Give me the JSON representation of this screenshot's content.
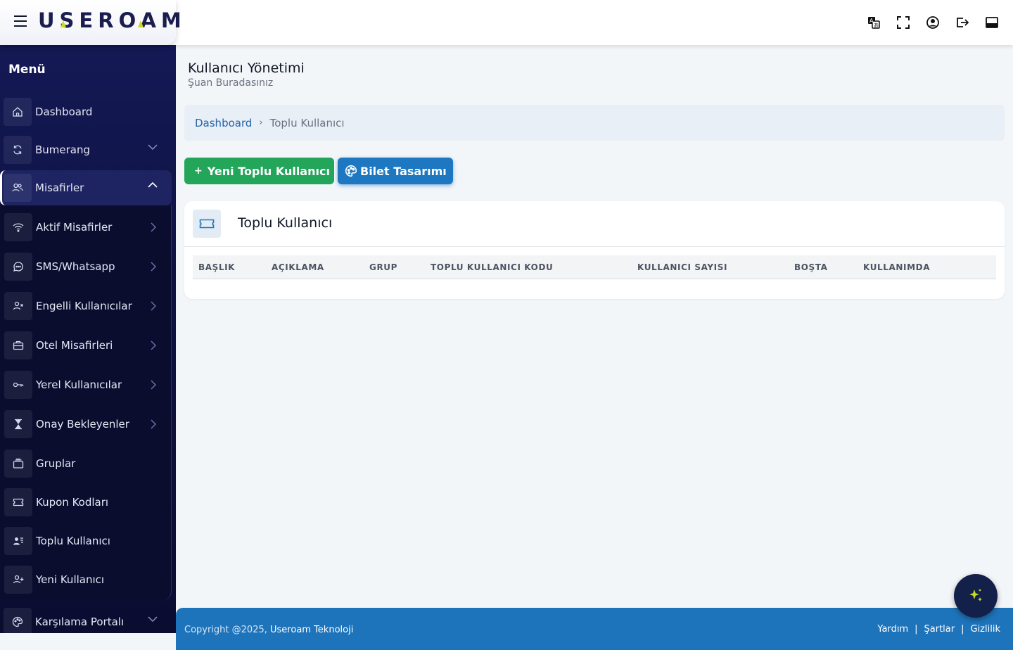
{
  "brand": {
    "logo_text": "USEROAM",
    "accent_color": "#c8d92b",
    "navy": "#1a1d4e"
  },
  "topbar": {
    "icons": [
      "translate-icon",
      "fullscreen-icon",
      "user-circle-icon",
      "logout-icon",
      "window-icon"
    ]
  },
  "sidebar": {
    "menu_title": "Menü",
    "items": [
      {
        "label": "Dashboard",
        "icon": "home-icon"
      },
      {
        "label": "Bumerang",
        "icon": "refresh-icon"
      },
      {
        "label": "Misafirler",
        "icon": "users-icon"
      }
    ],
    "sub_items": [
      {
        "label": "Aktif Misafirler",
        "icon": "wifi-icon"
      },
      {
        "label": "SMS/Whatsapp",
        "icon": "chat-icon"
      },
      {
        "label": "Engelli Kullanıcılar",
        "icon": "user-x-icon"
      },
      {
        "label": "Otel Misafirleri",
        "icon": "briefcase-icon"
      },
      {
        "label": "Yerel Kullanıcılar",
        "icon": "key-icon"
      },
      {
        "label": "Onay Bekleyenler",
        "icon": "hourglass-icon"
      },
      {
        "label": "Gruplar",
        "icon": "folder-stack-icon"
      },
      {
        "label": "Kupon Kodları",
        "icon": "ticket-icon"
      },
      {
        "label": "Toplu Kullanıcı",
        "icon": "user-list-icon"
      },
      {
        "label": "Yeni Kullanıcı",
        "icon": "user-plus-icon"
      }
    ],
    "bottom_item": {
      "label": "Karşılama Portalı",
      "icon": "palette-icon"
    }
  },
  "header": {
    "title": "Kullanıcı Yönetimi",
    "subtitle": "Şuan Buradasınız"
  },
  "breadcrumb": {
    "link": "Dashboard",
    "separator": "›",
    "current": "Toplu Kullanıcı"
  },
  "actions": {
    "new_button": "Yeni Toplu Kullanıcı",
    "new_icon": "+",
    "design_button": "Bilet Tasarımı"
  },
  "card": {
    "title": "Toplu Kullanıcı",
    "columns": [
      "BAŞLIK",
      "AÇIKLAMA",
      "GRUP",
      "TOPLU KULLANICI KODU",
      "KULLANICI SAYISI",
      "BOŞTA",
      "KULLANIMDA"
    ]
  },
  "footer": {
    "copyright": "Copyright @2025,",
    "company": "Useroam Teknoloji",
    "links": [
      "Yardım",
      "Şartlar",
      "Gizlilik"
    ],
    "divider": "|"
  },
  "colors": {
    "green": "#23a55a",
    "blue": "#1d78c1",
    "sidebar": "#0e1242",
    "footer": "#1e74bb"
  }
}
